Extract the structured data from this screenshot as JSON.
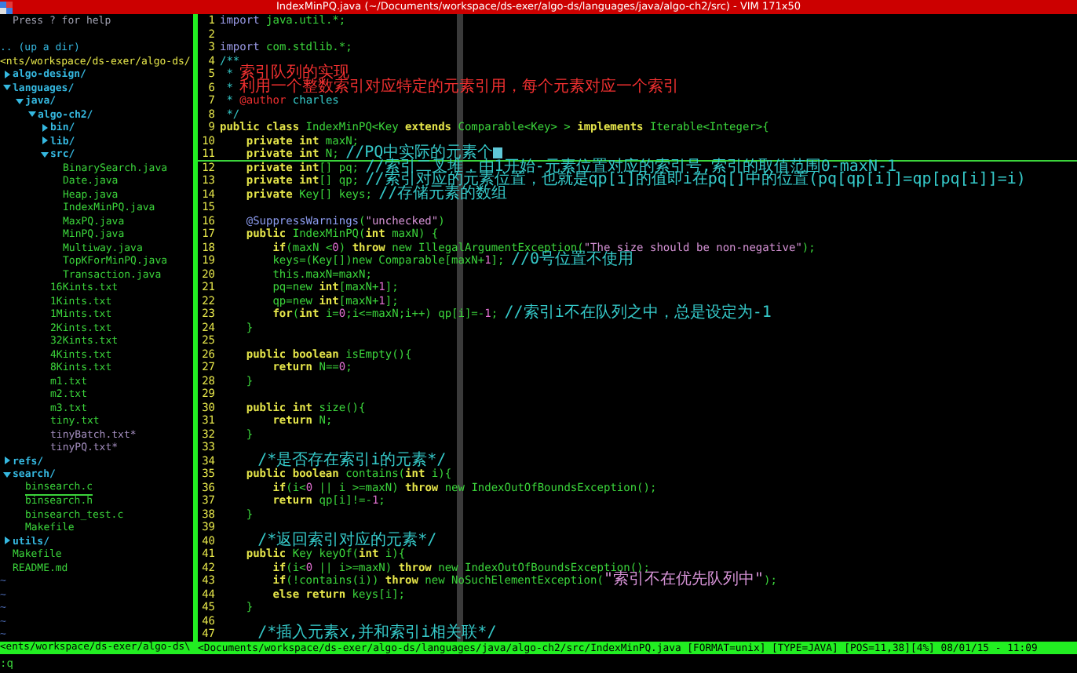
{
  "window": {
    "title": "IndexMinPQ.java (~/Documents/workspace/ds-exer/algo-ds/languages/java/algo-ch2/src) - VIM 171x50"
  },
  "explorer": {
    "help": "Press ? for help",
    "up_dir": ".. (up a dir)",
    "path": "<nts/workspace/ds-exer/algo-ds/",
    "tree": [
      {
        "name": "algo-design/",
        "kind": "dir",
        "expanded": false,
        "selected": false
      },
      {
        "name": "languages/",
        "kind": "dir",
        "expanded": true,
        "selected": false,
        "children": [
          {
            "name": "java/",
            "kind": "dir",
            "expanded": true,
            "selected": false,
            "children": [
              {
                "name": "algo-ch2/",
                "kind": "dir",
                "expanded": true,
                "selected": false,
                "children": [
                  {
                    "name": "bin/",
                    "kind": "dir",
                    "expanded": false,
                    "selected": false
                  },
                  {
                    "name": "lib/",
                    "kind": "dir",
                    "expanded": false,
                    "selected": false
                  },
                  {
                    "name": "src/",
                    "kind": "dir",
                    "expanded": true,
                    "selected": false,
                    "children": [
                      {
                        "name": "BinarySearch.java",
                        "kind": "file",
                        "selected": false
                      },
                      {
                        "name": "Date.java",
                        "kind": "file",
                        "selected": false
                      },
                      {
                        "name": "Heap.java",
                        "kind": "file",
                        "selected": false
                      },
                      {
                        "name": "IndexMinPQ.java",
                        "kind": "file",
                        "selected": false
                      },
                      {
                        "name": "MaxPQ.java",
                        "kind": "file",
                        "selected": false
                      },
                      {
                        "name": "MinPQ.java",
                        "kind": "file",
                        "selected": false
                      },
                      {
                        "name": "Multiway.java",
                        "kind": "file",
                        "selected": false
                      },
                      {
                        "name": "TopKForMinPQ.java",
                        "kind": "file",
                        "selected": false
                      },
                      {
                        "name": "Transaction.java",
                        "kind": "file",
                        "selected": false
                      }
                    ]
                  },
                  {
                    "name": "16Kints.txt",
                    "kind": "file",
                    "selected": false
                  },
                  {
                    "name": "1Kints.txt",
                    "kind": "file",
                    "selected": false
                  },
                  {
                    "name": "1Mints.txt",
                    "kind": "file",
                    "selected": false
                  },
                  {
                    "name": "2Kints.txt",
                    "kind": "file",
                    "selected": false
                  },
                  {
                    "name": "32Kints.txt",
                    "kind": "file",
                    "selected": false
                  },
                  {
                    "name": "4Kints.txt",
                    "kind": "file",
                    "selected": false
                  },
                  {
                    "name": "8Kints.txt",
                    "kind": "file",
                    "selected": false
                  },
                  {
                    "name": "m1.txt",
                    "kind": "file",
                    "selected": false
                  },
                  {
                    "name": "m2.txt",
                    "kind": "file",
                    "selected": false
                  },
                  {
                    "name": "m3.txt",
                    "kind": "file",
                    "selected": false
                  },
                  {
                    "name": "tiny.txt",
                    "kind": "file",
                    "selected": false
                  },
                  {
                    "name": "tinyBatch.txt*",
                    "kind": "exec",
                    "selected": false
                  },
                  {
                    "name": "tinyPQ.txt*",
                    "kind": "exec",
                    "selected": false
                  }
                ]
              }
            ]
          }
        ]
      },
      {
        "name": "refs/",
        "kind": "dir",
        "expanded": false,
        "selected": false
      },
      {
        "name": "search/",
        "kind": "dir",
        "expanded": true,
        "selected": false,
        "children": [
          {
            "name": "binsearch.c",
            "kind": "file",
            "selected": true
          },
          {
            "name": "binsearch.h",
            "kind": "file",
            "selected": false
          },
          {
            "name": "binsearch_test.c",
            "kind": "file",
            "selected": false
          },
          {
            "name": "Makefile",
            "kind": "file",
            "selected": false
          }
        ]
      },
      {
        "name": "utils/",
        "kind": "dir",
        "expanded": false,
        "selected": false
      },
      {
        "name": "Makefile",
        "kind": "file",
        "selected": false
      },
      {
        "name": "README.md",
        "kind": "file",
        "selected": false
      }
    ],
    "empty_lines": [
      "~",
      "~",
      "~",
      "~",
      "~"
    ]
  },
  "editor": {
    "lines": [
      {
        "number": "1",
        "selected": false,
        "tokens": [
          {
            "text": "import",
            "kind": "pre"
          },
          {
            "text": " java.util.*;",
            "kind": "plain"
          }
        ]
      },
      {
        "number": "2",
        "selected": false
      },
      {
        "number": "3",
        "selected": false,
        "tokens": [
          {
            "text": "import",
            "kind": "pre"
          },
          {
            "text": " com.stdlib.*;",
            "kind": "plain"
          }
        ]
      },
      {
        "number": "4",
        "selected": false,
        "tokens": [
          {
            "text": "/**",
            "kind": "comment"
          }
        ]
      },
      {
        "number": "5",
        "selected": false,
        "tokens": [
          {
            "text": " * ",
            "kind": "comment"
          },
          {
            "text": "索引队列的实现",
            "kind": "doc-cn"
          }
        ]
      },
      {
        "number": "6",
        "selected": false,
        "tokens": [
          {
            "text": " * ",
            "kind": "comment"
          },
          {
            "text": "利用一个整数索引对应特定的元素引用，每个元素对应一个索引",
            "kind": "doc-cn"
          }
        ]
      },
      {
        "number": "7",
        "selected": false,
        "tokens": [
          {
            "text": " * ",
            "kind": "comment"
          },
          {
            "text": "@author",
            "kind": "doc"
          },
          {
            "text": " charles",
            "kind": "comment"
          }
        ]
      },
      {
        "number": "8",
        "selected": false,
        "tokens": [
          {
            "text": " */",
            "kind": "comment"
          }
        ]
      },
      {
        "number": "9",
        "selected": false,
        "tokens": [
          {
            "text": "public class",
            "kind": "kw"
          },
          {
            "text": " IndexMinPQ<Key ",
            "kind": "plain"
          },
          {
            "text": "extends",
            "kind": "kw"
          },
          {
            "text": " Comparable<Key> > ",
            "kind": "plain"
          },
          {
            "text": "implements",
            "kind": "kw"
          },
          {
            "text": " Iterable<Integer>{",
            "kind": "plain"
          }
        ]
      },
      {
        "number": "10",
        "selected": false,
        "tokens": [
          {
            "text": "    private int",
            "kind": "kw"
          },
          {
            "text": " maxN;",
            "kind": "plain"
          }
        ]
      },
      {
        "number": "11",
        "selected": true,
        "tokens": [
          {
            "text": "    private int",
            "kind": "kw"
          },
          {
            "text": " N; ",
            "kind": "plain"
          },
          {
            "text": "//PQ中实际的元素个",
            "kind": "note"
          },
          {
            "kind": "cursor"
          }
        ]
      },
      {
        "number": "12",
        "selected": false,
        "tokens": [
          {
            "text": "    private int",
            "kind": "kw"
          },
          {
            "text": "[] pq; ",
            "kind": "plain"
          },
          {
            "text": "//索引二叉堆，由1开始-元素位置对应的索引号,索引的取值范围0-maxN-1",
            "kind": "note"
          }
        ]
      },
      {
        "number": "13",
        "selected": false,
        "tokens": [
          {
            "text": "    private int",
            "kind": "kw"
          },
          {
            "text": "[] qp; ",
            "kind": "plain"
          },
          {
            "text": "//索引对应的元素位置，也就是qp[i]的值即i在pq[]中的位置(pq[qp[i]]=qp[pq[i]]=i)",
            "kind": "note"
          }
        ]
      },
      {
        "number": "14",
        "selected": false,
        "tokens": [
          {
            "text": "    private ",
            "kind": "kw"
          },
          {
            "text": "Key[] keys; ",
            "kind": "plain"
          },
          {
            "text": "//存储元素的数组",
            "kind": "note"
          }
        ]
      },
      {
        "number": "15",
        "selected": false
      },
      {
        "number": "16",
        "selected": false,
        "tokens": [
          {
            "text": "    @SuppressWarnings",
            "kind": "annot"
          },
          {
            "text": "(",
            "kind": "plain"
          },
          {
            "text": "\"unchecked\"",
            "kind": "str"
          },
          {
            "text": ")",
            "kind": "plain"
          }
        ]
      },
      {
        "number": "17",
        "selected": false,
        "tokens": [
          {
            "text": "    public ",
            "kind": "kw"
          },
          {
            "text": "IndexMinPQ(",
            "kind": "plain"
          },
          {
            "text": "int",
            "kind": "kw"
          },
          {
            "text": " maxN) {",
            "kind": "plain"
          }
        ]
      },
      {
        "number": "18",
        "selected": false,
        "tokens": [
          {
            "text": "        if",
            "kind": "kw"
          },
          {
            "text": "(maxN <",
            "kind": "plain"
          },
          {
            "text": "0",
            "kind": "num"
          },
          {
            "text": ") ",
            "kind": "plain"
          },
          {
            "text": "throw",
            "kind": "kw"
          },
          {
            "text": " new IllegalArgumentException(",
            "kind": "plain"
          },
          {
            "text": "\"The size should be non-negative\"",
            "kind": "str"
          },
          {
            "text": ");",
            "kind": "plain"
          }
        ]
      },
      {
        "number": "19",
        "selected": false,
        "tokens": [
          {
            "text": "        keys=(Key[])new Comparable[maxN+",
            "kind": "plain"
          },
          {
            "text": "1",
            "kind": "num"
          },
          {
            "text": "]; ",
            "kind": "plain"
          },
          {
            "text": "//0号位置不使用",
            "kind": "note"
          }
        ]
      },
      {
        "number": "20",
        "selected": false,
        "tokens": [
          {
            "text": "        this.maxN=maxN;",
            "kind": "plain"
          }
        ]
      },
      {
        "number": "21",
        "selected": false,
        "tokens": [
          {
            "text": "        pq=new ",
            "kind": "plain"
          },
          {
            "text": "int",
            "kind": "kw"
          },
          {
            "text": "[maxN+",
            "kind": "plain"
          },
          {
            "text": "1",
            "kind": "num"
          },
          {
            "text": "];",
            "kind": "plain"
          }
        ]
      },
      {
        "number": "22",
        "selected": false,
        "tokens": [
          {
            "text": "        qp=new ",
            "kind": "plain"
          },
          {
            "text": "int",
            "kind": "kw"
          },
          {
            "text": "[maxN+",
            "kind": "plain"
          },
          {
            "text": "1",
            "kind": "num"
          },
          {
            "text": "];",
            "kind": "plain"
          }
        ]
      },
      {
        "number": "23",
        "selected": false,
        "tokens": [
          {
            "text": "        for",
            "kind": "kw"
          },
          {
            "text": "(",
            "kind": "plain"
          },
          {
            "text": "int",
            "kind": "kw"
          },
          {
            "text": " i=",
            "kind": "plain"
          },
          {
            "text": "0",
            "kind": "num"
          },
          {
            "text": ";i<=maxN;i++) qp[i]=-",
            "kind": "plain"
          },
          {
            "text": "1",
            "kind": "num"
          },
          {
            "text": "; ",
            "kind": "plain"
          },
          {
            "text": "//索引i不在队列之中，总是设定为-1",
            "kind": "note"
          }
        ]
      },
      {
        "number": "24",
        "selected": false,
        "tokens": [
          {
            "text": "    }",
            "kind": "plain"
          }
        ]
      },
      {
        "number": "25",
        "selected": false
      },
      {
        "number": "26",
        "selected": false,
        "tokens": [
          {
            "text": "    public boolean",
            "kind": "kw"
          },
          {
            "text": " isEmpty(){",
            "kind": "plain"
          }
        ]
      },
      {
        "number": "27",
        "selected": false,
        "tokens": [
          {
            "text": "        return",
            "kind": "kw"
          },
          {
            "text": " N==",
            "kind": "plain"
          },
          {
            "text": "0",
            "kind": "num"
          },
          {
            "text": ";",
            "kind": "plain"
          }
        ]
      },
      {
        "number": "28",
        "selected": false,
        "tokens": [
          {
            "text": "    }",
            "kind": "plain"
          }
        ]
      },
      {
        "number": "29",
        "selected": false
      },
      {
        "number": "30",
        "selected": false,
        "tokens": [
          {
            "text": "    public int",
            "kind": "kw"
          },
          {
            "text": " size(){",
            "kind": "plain"
          }
        ]
      },
      {
        "number": "31",
        "selected": false,
        "tokens": [
          {
            "text": "        return",
            "kind": "kw"
          },
          {
            "text": " N;",
            "kind": "plain"
          }
        ]
      },
      {
        "number": "32",
        "selected": false,
        "tokens": [
          {
            "text": "    }",
            "kind": "plain"
          }
        ]
      },
      {
        "number": "33",
        "selected": false
      },
      {
        "number": "34",
        "selected": false,
        "tokens": [
          {
            "text": "    /*是否存在索引i的元素*/",
            "kind": "note"
          }
        ]
      },
      {
        "number": "35",
        "selected": false,
        "tokens": [
          {
            "text": "    public boolean",
            "kind": "kw"
          },
          {
            "text": " contains(",
            "kind": "plain"
          },
          {
            "text": "int",
            "kind": "kw"
          },
          {
            "text": " i){",
            "kind": "plain"
          }
        ]
      },
      {
        "number": "36",
        "selected": false,
        "tokens": [
          {
            "text": "        if",
            "kind": "kw"
          },
          {
            "text": "(i<",
            "kind": "plain"
          },
          {
            "text": "0",
            "kind": "num"
          },
          {
            "text": " || i >=maxN) ",
            "kind": "plain"
          },
          {
            "text": "throw",
            "kind": "kw"
          },
          {
            "text": " new IndexOutOfBoundsException();",
            "kind": "plain"
          }
        ]
      },
      {
        "number": "37",
        "selected": false,
        "tokens": [
          {
            "text": "        return",
            "kind": "kw"
          },
          {
            "text": " qp[i]!=-",
            "kind": "plain"
          },
          {
            "text": "1",
            "kind": "num"
          },
          {
            "text": ";",
            "kind": "plain"
          }
        ]
      },
      {
        "number": "38",
        "selected": false,
        "tokens": [
          {
            "text": "    }",
            "kind": "plain"
          }
        ]
      },
      {
        "number": "39",
        "selected": false
      },
      {
        "number": "40",
        "selected": false,
        "tokens": [
          {
            "text": "    /*返回索引对应的元素*/",
            "kind": "note"
          }
        ]
      },
      {
        "number": "41",
        "selected": false,
        "tokens": [
          {
            "text": "    public",
            "kind": "kw"
          },
          {
            "text": " Key keyOf(",
            "kind": "plain"
          },
          {
            "text": "int",
            "kind": "kw"
          },
          {
            "text": " i){",
            "kind": "plain"
          }
        ]
      },
      {
        "number": "42",
        "selected": false,
        "tokens": [
          {
            "text": "        if",
            "kind": "kw"
          },
          {
            "text": "(i<",
            "kind": "plain"
          },
          {
            "text": "0",
            "kind": "num"
          },
          {
            "text": " || i>=maxN) ",
            "kind": "plain"
          },
          {
            "text": "throw",
            "kind": "kw"
          },
          {
            "text": " new IndexOutOfBoundsException();",
            "kind": "plain"
          }
        ]
      },
      {
        "number": "43",
        "selected": false,
        "tokens": [
          {
            "text": "        if",
            "kind": "kw"
          },
          {
            "text": "(!contains(i)) ",
            "kind": "plain"
          },
          {
            "text": "throw",
            "kind": "kw"
          },
          {
            "text": " new NoSuchElementException(",
            "kind": "plain"
          },
          {
            "text": "\"索引不在优先队列中\"",
            "kind": "str-cn"
          },
          {
            "text": ");",
            "kind": "plain"
          }
        ]
      },
      {
        "number": "44",
        "selected": false,
        "tokens": [
          {
            "text": "        else return",
            "kind": "kw"
          },
          {
            "text": " keys[i];",
            "kind": "plain"
          }
        ]
      },
      {
        "number": "45",
        "selected": false,
        "tokens": [
          {
            "text": "    }",
            "kind": "plain"
          }
        ]
      },
      {
        "number": "46",
        "selected": false
      },
      {
        "number": "47",
        "selected": false,
        "tokens": [
          {
            "text": "    /*插入元素x,并和索引i相关联*/",
            "kind": "note"
          }
        ]
      }
    ]
  },
  "status_bar": {
    "explorer_path": "<ents/workspace/ds-exer/algo-ds\\",
    "file_status": "<Documents/workspace/ds-exer/algo-ds/languages/java/algo-ch2/src/IndexMinPQ.java [FORMAT=unix] [TYPE=JAVA] [POS=11,38][4%] 08/01/15 - 11:09"
  },
  "command_line": ":q"
}
